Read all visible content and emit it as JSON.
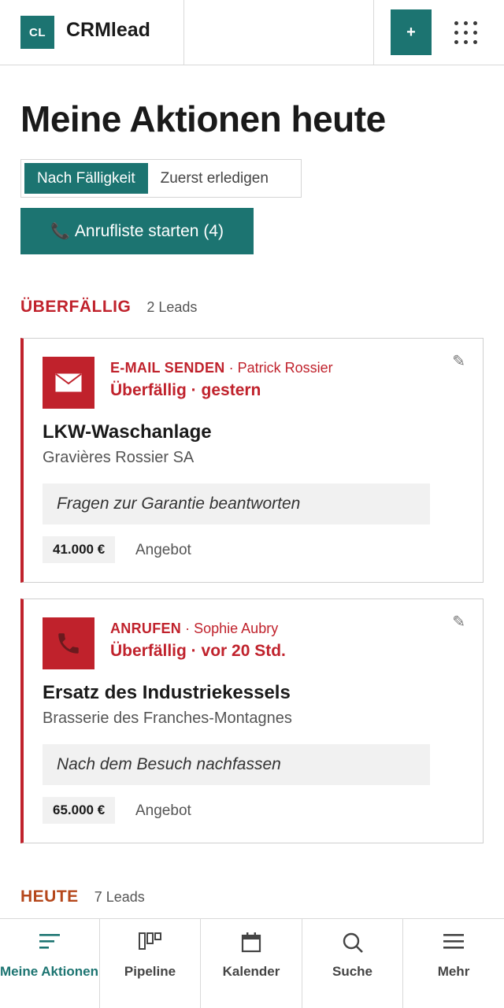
{
  "header": {
    "logo_text": "CL",
    "app_name": "CRMlead",
    "add_label": "+",
    "apps_icon": "grid-dots-icon"
  },
  "page": {
    "title": "Meine Aktionen heute"
  },
  "sort_toggle": {
    "options": [
      "Nach Fälligkeit",
      "Zuerst erledigen"
    ],
    "selected": "Nach Fälligkeit"
  },
  "call_list_button": {
    "icon": "phone-icon",
    "label": "Anrufliste starten (4)"
  },
  "sections": [
    {
      "label": "ÜBERFÄLLIG",
      "count": "2 Leads",
      "color": "#c0222c",
      "cards": [
        {
          "icon": "envelope-icon",
          "action_type": "E-MAIL SENDEN",
          "contact": "· Patrick Rossier",
          "due": "Überfällig · gestern",
          "title": "LKW-Waschanlage",
          "company": "Gravières Rossier SA",
          "note": "Fragen zur Garantie beantworten",
          "amount": "41.000 €",
          "stage": "Angebot"
        },
        {
          "icon": "phone-icon",
          "action_type": "ANRUFEN",
          "contact": "· Sophie Aubry",
          "due": "Überfällig · vor 20 Std.",
          "title": "Ersatz des Industriekessels",
          "company": "Brasserie des Franches-Montagnes",
          "note": "Nach dem Besuch nachfassen",
          "amount": "65.000 €",
          "stage": "Angebot"
        }
      ]
    },
    {
      "label": "HEUTE",
      "count": "7 Leads",
      "color": "#b5471b"
    }
  ],
  "bottom_nav": {
    "items": [
      {
        "label": "Meine Aktionen",
        "icon": "list-sort-icon",
        "active": true
      },
      {
        "label": "Pipeline",
        "icon": "kanban-icon",
        "active": false
      },
      {
        "label": "Kalender",
        "icon": "calendar-icon",
        "active": false
      },
      {
        "label": "Suche",
        "icon": "search-icon",
        "active": false
      },
      {
        "label": "Mehr",
        "icon": "menu-icon",
        "active": false
      }
    ]
  },
  "colors": {
    "accent": "#1c7471",
    "overdue": "#c0222c",
    "today": "#b5471b"
  }
}
